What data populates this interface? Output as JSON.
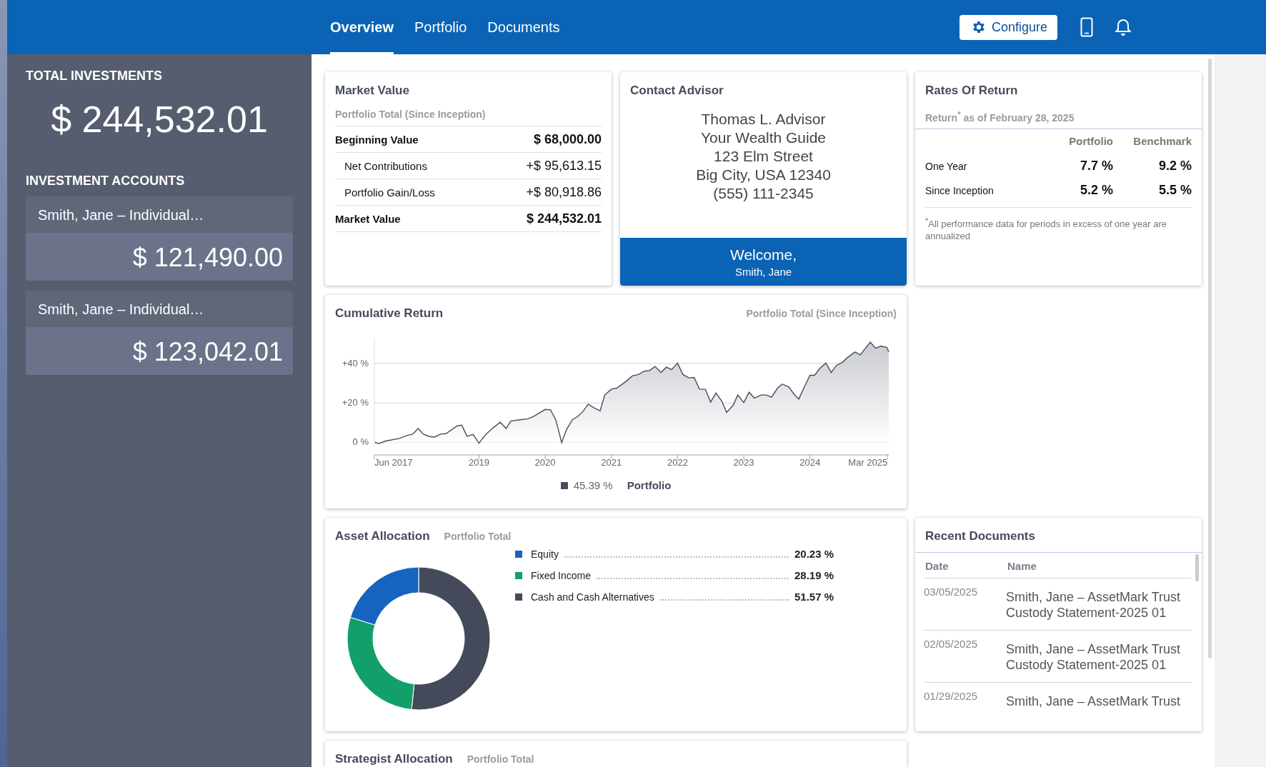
{
  "top_bar": {
    "tabs": [
      {
        "label": "Overview",
        "selected": true
      },
      {
        "label": "Portfolio",
        "selected": false
      },
      {
        "label": "Documents",
        "selected": false
      }
    ],
    "configure_button": "Configure"
  },
  "sidebar": {
    "total_label": "TOTAL INVESTMENTS",
    "total_value": "$ 244,532.01",
    "accounts_label": "INVESTMENT ACCOUNTS",
    "accounts": [
      {
        "name": "Smith, Jane – Individual…",
        "value": "$ 121,490.00"
      },
      {
        "name": "Smith, Jane – Individual…",
        "value": "$ 123,042.01"
      }
    ]
  },
  "market_value": {
    "title": "Market Value",
    "subtitle": "Portfolio Total (Since Inception)",
    "rows": [
      {
        "label": "Beginning Value",
        "value": "$ 68,000.00",
        "kind": "total"
      },
      {
        "label": "Net Contributions",
        "value": "+$ 95,613.15",
        "kind": "detail"
      },
      {
        "label": "Portfolio Gain/Loss",
        "value": "+$ 80,918.86",
        "kind": "detail"
      },
      {
        "label": "Market Value",
        "value": "$ 244,532.01",
        "kind": "total"
      }
    ]
  },
  "contact_advisor": {
    "title": "Contact Advisor",
    "lines": [
      "Thomas L. Advisor",
      "Your Wealth Guide",
      "123 Elm Street",
      "Big City, USA 12340",
      "(555) 111-2345"
    ],
    "welcome": "Welcome,",
    "client": "Smith, Jane"
  },
  "rates_of_return": {
    "title": "Rates Of Return",
    "subtitle": "Return$^{*}$ as of February 28, 2025",
    "columns": [
      "Portfolio",
      "Benchmark"
    ],
    "rows": [
      {
        "label": "One Year",
        "values": [
          "7.7 %",
          "9.2 %"
        ]
      },
      {
        "label": "Since Inception",
        "values": [
          "5.2 %",
          "5.5 %"
        ]
      }
    ],
    "footnote": "$^{*}$All performance data for periods in excess of one year are annualized"
  },
  "cumulative_return": {
    "title": "Cumulative Return",
    "subtitle": "Portfolio Total (Since Inception)",
    "legend_value": "45.39 %",
    "chart_data": {
      "type": "area",
      "grid": true,
      "xlim": [
        2017.42,
        2025.19
      ],
      "ylim": [
        -2,
        53
      ],
      "xticks": [
        {
          "value": 2017.42,
          "label": "Jun 2017"
        },
        {
          "value": 2019,
          "label": "2019"
        },
        {
          "value": 2020,
          "label": "2020"
        },
        {
          "value": 2021,
          "label": "2021"
        },
        {
          "value": 2022,
          "label": "2022"
        },
        {
          "value": 2023,
          "label": "2023"
        },
        {
          "value": 2024,
          "label": "2024"
        },
        {
          "value": 2025.17,
          "label": "Mar 2025"
        }
      ],
      "yticks": [
        {
          "value": 0,
          "label": "0 %"
        },
        {
          "value": 20,
          "label": "+20 %"
        },
        {
          "value": 40,
          "label": "+40 %"
        }
      ],
      "x": [
        2017.42,
        2017.49,
        2017.58,
        2017.8,
        2017.91,
        2018.0,
        2018.08,
        2018.16,
        2018.25,
        2018.33,
        2018.42,
        2018.5,
        2018.67,
        2018.74,
        2018.82,
        2018.91,
        2019.0,
        2019.09,
        2019.2,
        2019.32,
        2019.41,
        2019.48,
        2019.62,
        2019.73,
        2019.82,
        2020.0,
        2020.08,
        2020.16,
        2020.25,
        2020.32,
        2020.41,
        2020.49,
        2020.57,
        2020.65,
        2020.74,
        2020.83,
        2020.9,
        2021.0,
        2021.08,
        2021.21,
        2021.32,
        2021.41,
        2021.49,
        2021.58,
        2021.66,
        2021.75,
        2021.83,
        2021.91,
        2022.0,
        2022.08,
        2022.17,
        2022.25,
        2022.33,
        2022.42,
        2022.5,
        2022.58,
        2022.67,
        2022.74,
        2022.84,
        2022.91,
        2023.0,
        2023.08,
        2023.16,
        2023.26,
        2023.34,
        2023.42,
        2023.51,
        2023.58,
        2023.68,
        2023.76,
        2023.83,
        2023.92,
        2024.0,
        2024.07,
        2024.15,
        2024.24,
        2024.32,
        2024.4,
        2024.49,
        2024.57,
        2024.68,
        2024.76,
        2024.82,
        2024.91,
        2024.99,
        2025.07,
        2025.16,
        2025.19
      ],
      "series": [
        {
          "name": "Portfolio",
          "color": "#474d5e",
          "values": [
            0,
            -0.6,
            0.6,
            2,
            3.5,
            4.2,
            7,
            4.2,
            3,
            2.7,
            4.2,
            4.4,
            8.3,
            8.7,
            3.1,
            4,
            -0.4,
            3.5,
            7,
            10.2,
            7,
            10.8,
            11.5,
            11.9,
            13.1,
            16.7,
            16.5,
            11.5,
            -0.2,
            6.3,
            11.5,
            13.1,
            15.6,
            19.4,
            17.5,
            16,
            24,
            27,
            27.5,
            30.6,
            33.8,
            34.4,
            36,
            36.5,
            38.5,
            35.4,
            38.1,
            36.9,
            40.2,
            34.4,
            32.7,
            32.9,
            27,
            26.9,
            20.4,
            25,
            20.8,
            15.2,
            18.8,
            24,
            20.2,
            25.4,
            22.5,
            24,
            24,
            22.9,
            27.5,
            29.6,
            28.1,
            24.4,
            21.9,
            28.5,
            34,
            34,
            37.5,
            40.2,
            35.4,
            39,
            40.6,
            43.1,
            45.8,
            44.4,
            47,
            50.8,
            47.7,
            48.8,
            48.1,
            45.9
          ]
        }
      ]
    }
  },
  "asset_allocation": {
    "title": "Asset Allocation",
    "subtitle": "Portfolio Total",
    "legend": [
      {
        "value": "20.23 %",
        "color": "#1565c0"
      },
      {
        "value": "28.19 %",
        "color": "#12a06a"
      },
      {
        "value": "51.57 %",
        "color": "#444a5a"
      }
    ],
    "chart_data": {
      "type": "donut",
      "categories": [
        "Equity",
        "Fixed Income",
        "Cash and Cash Alternatives"
      ],
      "values": [
        20.23,
        28.19,
        51.57
      ]
    }
  },
  "recent_documents": {
    "title": "Recent Documents",
    "columns": [
      "Date",
      "Name"
    ],
    "rows": [
      {
        "date": "03/05/2025",
        "name": "Smith, Jane – AssetMark Trust Custody Statement-2025 01"
      },
      {
        "date": "02/05/2025",
        "name": "Smith, Jane – AssetMark Trust Custody Statement-2025 01"
      },
      {
        "date": "01/29/2025",
        "name": "Smith, Jane – AssetMark Trust"
      }
    ]
  },
  "strategist_allocation": {
    "title": "Strategist Allocation",
    "subtitle": "Portfolio Total"
  }
}
